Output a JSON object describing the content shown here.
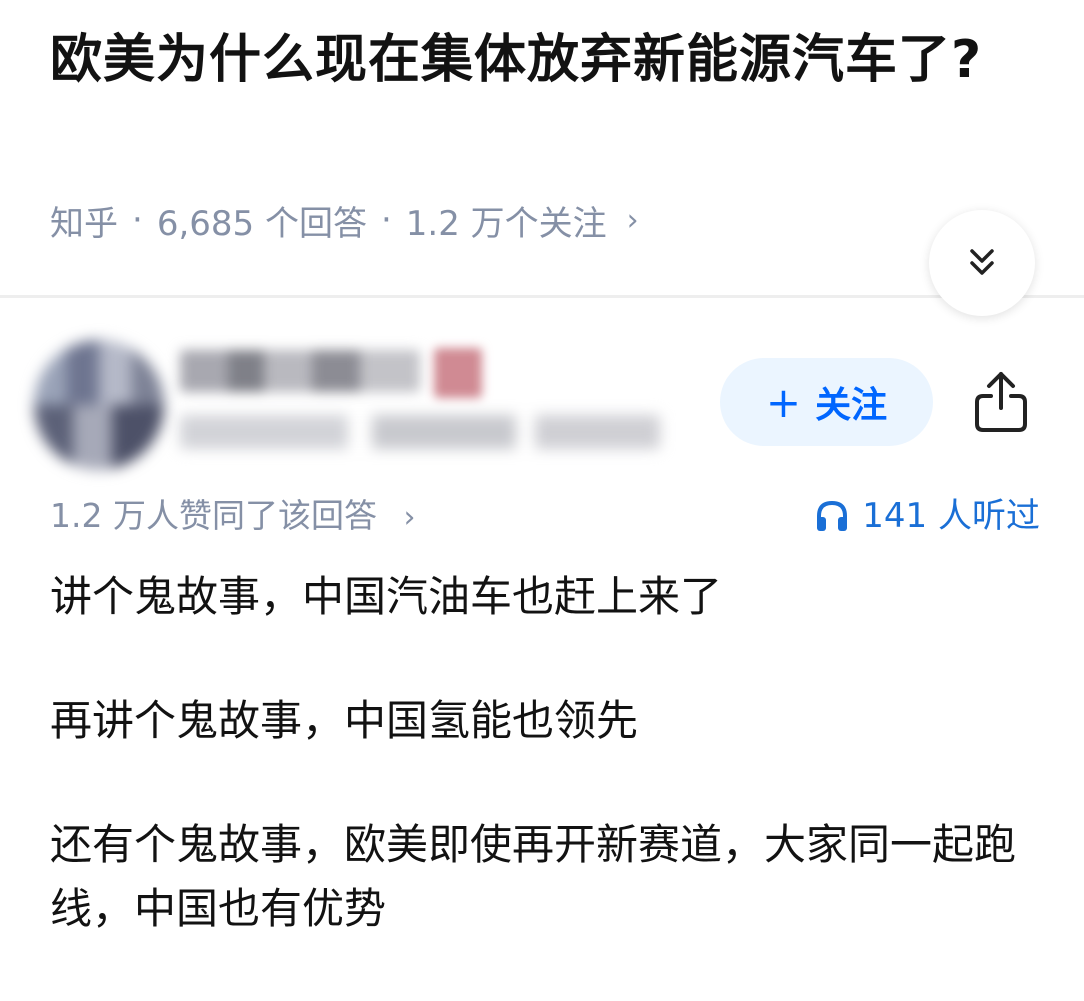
{
  "question": {
    "title": "欧美为什么现在集体放弃新能源汽车了?",
    "source": "知乎",
    "answer_count": "6,685 个回答",
    "follower_count": "1.2 万个关注",
    "separator": "·",
    "chevron": "›"
  },
  "icons": {
    "collapse": "double-chevron-down-icon",
    "share": "share-icon",
    "headphones": "headphones-icon"
  },
  "author": {
    "follow_plus": "+",
    "follow_label": "关注"
  },
  "stats": {
    "upvotes": "1.2 万人赞同了该回答",
    "chevron": "›",
    "listens": "141 人听过"
  },
  "answer": {
    "paragraphs": [
      "讲个鬼故事，中国汽油车也赶上来了",
      "再讲个鬼故事，中国氢能也领先",
      "还有个鬼故事，欧美即使再开新赛道，大家同一起跑线，中国也有优势"
    ]
  },
  "colors": {
    "accent": "#0066ff",
    "follow_bg": "#ebf5ff",
    "meta_text": "#8590a6",
    "listen_text": "#1a6fd6"
  }
}
